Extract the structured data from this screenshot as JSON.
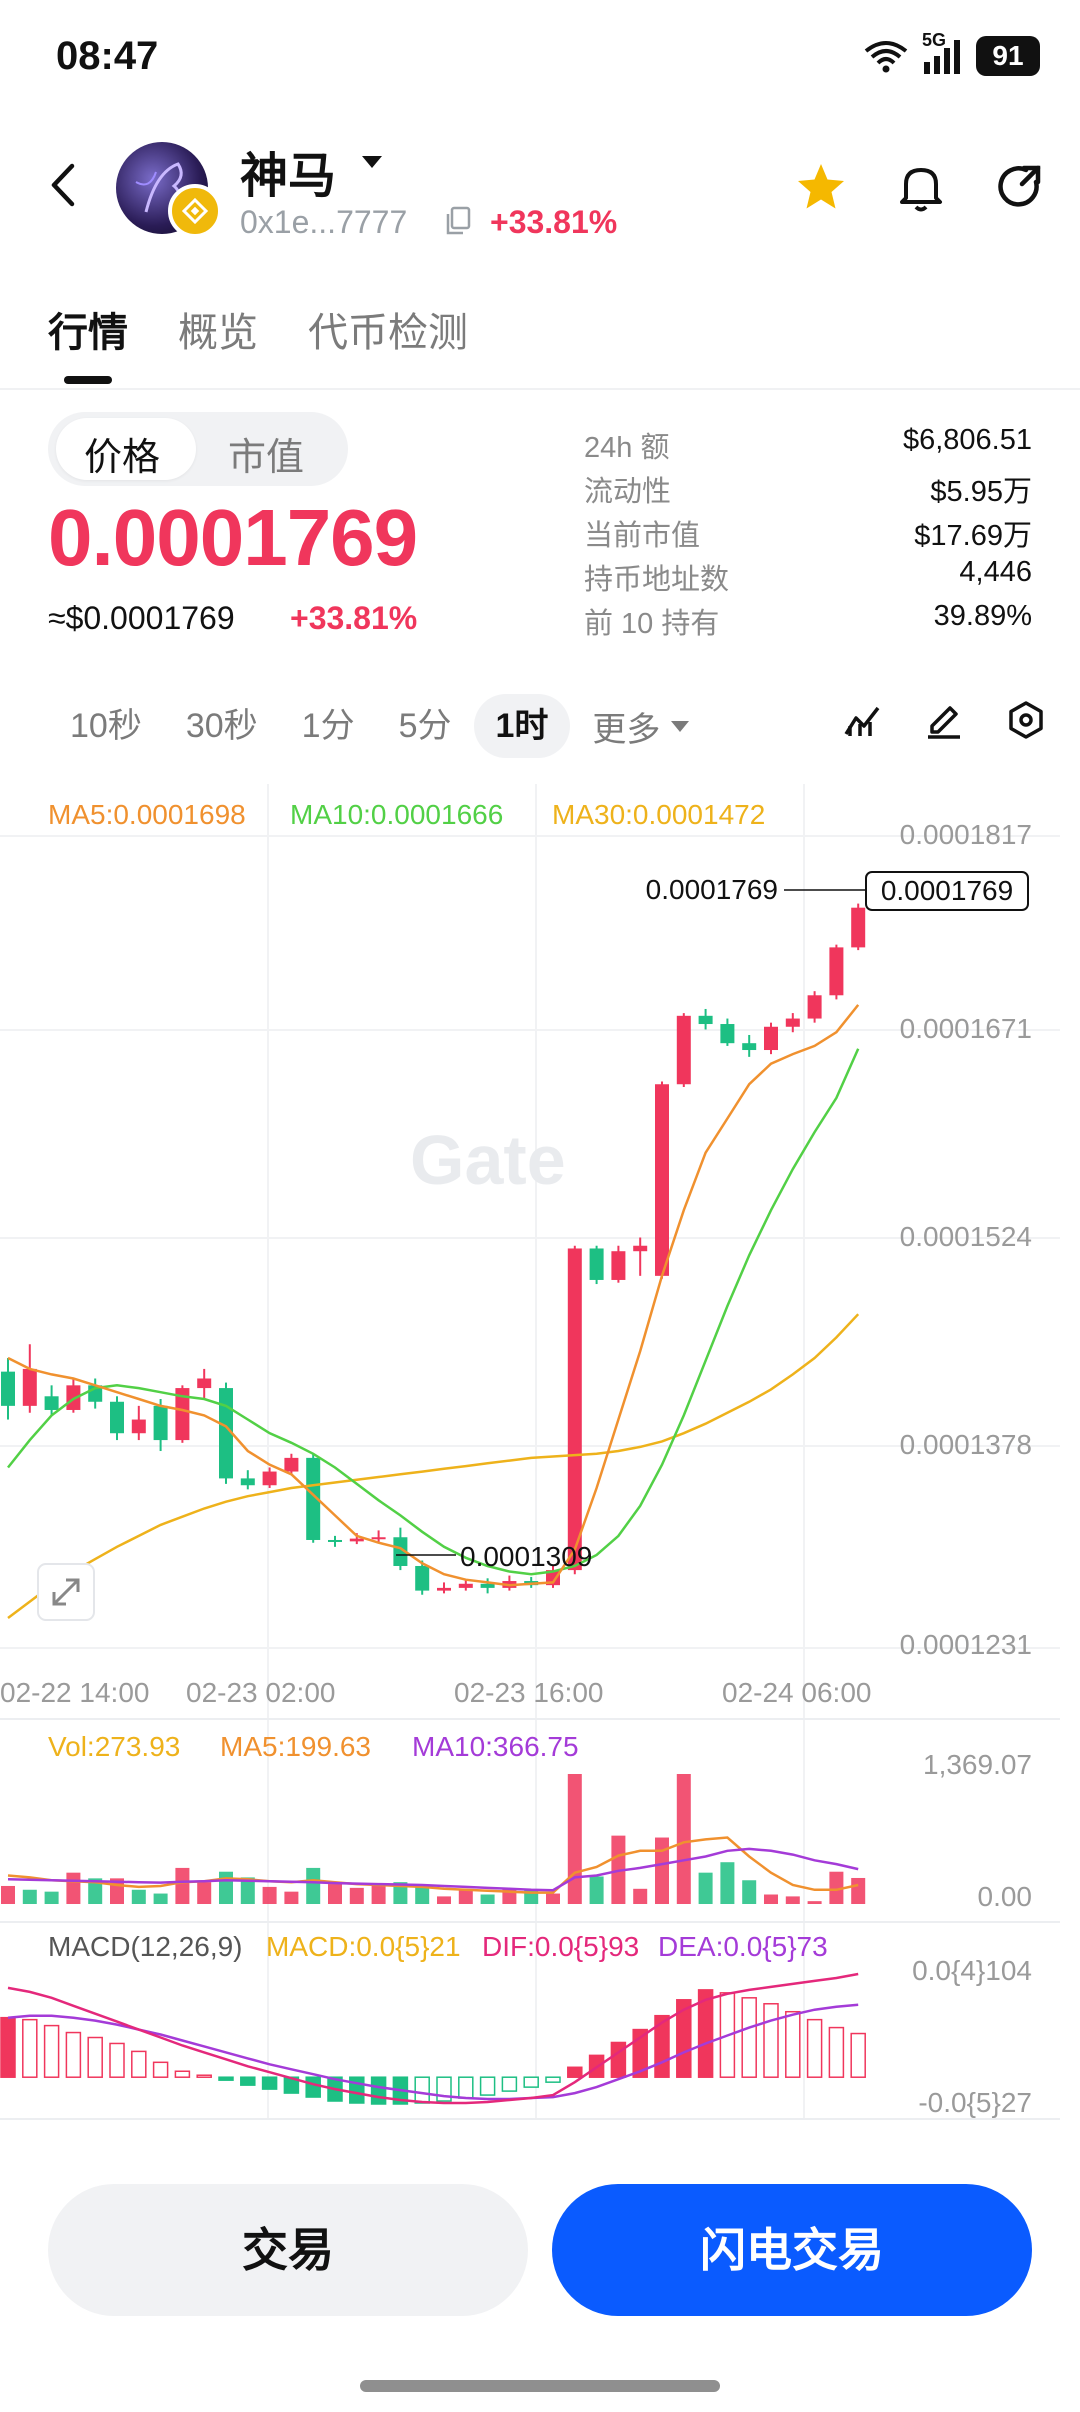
{
  "status": {
    "time": "08:47",
    "network": "5G",
    "battery": "91"
  },
  "header": {
    "token_name": "神马",
    "address": "0x1e...7777",
    "change": "+33.81%",
    "icons": [
      "back-icon",
      "dropdown-icon",
      "copy-icon",
      "star-icon",
      "bell-icon",
      "share-icon"
    ]
  },
  "tabs": [
    "行情",
    "概览",
    "代币检测"
  ],
  "price_panel": {
    "toggle": [
      "价格",
      "市值"
    ],
    "price": "0.0001769",
    "usd": "≈$0.0001769",
    "change": "+33.81%",
    "stats": [
      {
        "label": "24h  额",
        "value": "$6,806.51"
      },
      {
        "label": "流动性",
        "value": "$5.95万"
      },
      {
        "label": "当前市值",
        "value": "$17.69万"
      },
      {
        "label": "持币地址数",
        "value": "4,446"
      },
      {
        "label": "前 10 持有",
        "value": "39.89%"
      }
    ]
  },
  "intervals": [
    "10秒",
    "30秒",
    "1分",
    "5分",
    "1时"
  ],
  "more_label": "更多",
  "main_chart": {
    "ma5": "MA5:0.0001698",
    "ma10": "MA10:0.0001666",
    "ma30": "MA30:0.0001472",
    "y_ticks": [
      "0.0001817",
      "0.0001671",
      "0.0001524",
      "0.0001378",
      "0.0001231"
    ],
    "x_ticks": [
      "02-22 14:00",
      "02-23 02:00",
      "02-23 16:00",
      "02-24 06:00"
    ],
    "current_label": "0.0001769",
    "current_box": "0.0001769",
    "low_label": "0.0001309",
    "watermark": "Gate"
  },
  "volume_chart": {
    "vol": "Vol:273.93",
    "ma5": "MA5:199.63",
    "ma10": "MA10:366.75",
    "y_top": "1,369.07",
    "y_bottom": "0.00"
  },
  "macd_chart": {
    "title": "MACD(12,26,9)",
    "macd": "MACD:0.0{5}21",
    "dif": "DIF:0.0{5}93",
    "dea": "DEA:0.0{5}73",
    "y_top": "0.0{4}104",
    "y_bottom": "-0.0{5}27"
  },
  "colors": {
    "up": "#f0365c",
    "down": "#1dbf83",
    "ma5": "#f0912f",
    "ma10": "#52d046",
    "ma30": "#eeb21b",
    "macd_dif": "#e4287b",
    "macd_dea": "#a43bd8",
    "accent": "#0a5bff"
  },
  "buttons": {
    "trade": "交易",
    "flash_trade": "闪电交易"
  },
  "chart_data": {
    "type": "candlestick",
    "candles": [
      {
        "o": 0.000143,
        "c": 0.0001405,
        "h": 0.000144,
        "l": 0.0001395
      },
      {
        "o": 0.0001405,
        "c": 0.0001432,
        "h": 0.000145,
        "l": 0.00014
      },
      {
        "o": 0.0001412,
        "c": 0.0001402,
        "h": 0.000142,
        "l": 0.0001398
      },
      {
        "o": 0.0001402,
        "c": 0.000142,
        "h": 0.0001425,
        "l": 0.00014
      },
      {
        "o": 0.000142,
        "c": 0.0001408,
        "h": 0.0001425,
        "l": 0.0001403
      },
      {
        "o": 0.0001408,
        "c": 0.0001385,
        "h": 0.0001412,
        "l": 0.000138
      },
      {
        "o": 0.0001385,
        "c": 0.0001395,
        "h": 0.0001405,
        "l": 0.000138
      },
      {
        "o": 0.0001405,
        "c": 0.000138,
        "h": 0.000141,
        "l": 0.0001372
      },
      {
        "o": 0.000138,
        "c": 0.0001418,
        "h": 0.000142,
        "l": 0.0001378
      },
      {
        "o": 0.0001418,
        "c": 0.0001425,
        "h": 0.0001432,
        "l": 0.000141
      },
      {
        "o": 0.0001418,
        "c": 0.0001352,
        "h": 0.0001422,
        "l": 0.0001348
      },
      {
        "o": 0.0001352,
        "c": 0.0001347,
        "h": 0.0001358,
        "l": 0.0001344
      },
      {
        "o": 0.0001347,
        "c": 0.0001357,
        "h": 0.000136,
        "l": 0.0001345
      },
      {
        "o": 0.0001357,
        "c": 0.0001367,
        "h": 0.000137,
        "l": 0.0001355
      },
      {
        "o": 0.0001367,
        "c": 0.0001307,
        "h": 0.000137,
        "l": 0.0001305
      },
      {
        "o": 0.0001307,
        "c": 0.0001306,
        "h": 0.000131,
        "l": 0.0001302
      },
      {
        "o": 0.0001306,
        "c": 0.0001308,
        "h": 0.0001312,
        "l": 0.0001304
      },
      {
        "o": 0.0001308,
        "c": 0.0001309,
        "h": 0.0001314,
        "l": 0.0001305
      },
      {
        "o": 0.0001309,
        "c": 0.0001288,
        "h": 0.0001316,
        "l": 0.0001285
      },
      {
        "o": 0.0001288,
        "c": 0.000127,
        "h": 0.0001292,
        "l": 0.0001267
      },
      {
        "o": 0.000127,
        "c": 0.0001272,
        "h": 0.0001276,
        "l": 0.0001268
      },
      {
        "o": 0.0001272,
        "c": 0.0001275,
        "h": 0.0001278,
        "l": 0.000127
      },
      {
        "o": 0.0001275,
        "c": 0.0001272,
        "h": 0.0001279,
        "l": 0.0001268
      },
      {
        "o": 0.0001272,
        "c": 0.0001277,
        "h": 0.0001281,
        "l": 0.000127
      },
      {
        "o": 0.0001277,
        "c": 0.0001274,
        "h": 0.000128,
        "l": 0.0001272
      },
      {
        "o": 0.0001274,
        "c": 0.0001285,
        "h": 0.0001288,
        "l": 0.0001272
      },
      {
        "o": 0.0001285,
        "c": 0.000152,
        "h": 0.0001522,
        "l": 0.0001282
      },
      {
        "o": 0.000152,
        "c": 0.0001497,
        "h": 0.0001522,
        "l": 0.0001494
      },
      {
        "o": 0.0001497,
        "c": 0.0001518,
        "h": 0.0001522,
        "l": 0.0001495
      },
      {
        "o": 0.0001518,
        "c": 0.0001522,
        "h": 0.0001528,
        "l": 0.00015
      },
      {
        "o": 0.00015,
        "c": 0.000164,
        "h": 0.0001642,
        "l": 0.0001498
      },
      {
        "o": 0.000164,
        "c": 0.000169,
        "h": 0.0001692,
        "l": 0.0001638
      },
      {
        "o": 0.000169,
        "c": 0.0001684,
        "h": 0.0001695,
        "l": 0.000168
      },
      {
        "o": 0.0001684,
        "c": 0.000167,
        "h": 0.0001688,
        "l": 0.0001668
      },
      {
        "o": 0.000167,
        "c": 0.0001665,
        "h": 0.0001676,
        "l": 0.000166
      },
      {
        "o": 0.0001665,
        "c": 0.0001682,
        "h": 0.0001685,
        "l": 0.0001662
      },
      {
        "o": 0.0001682,
        "c": 0.0001688,
        "h": 0.0001692,
        "l": 0.0001678
      },
      {
        "o": 0.0001688,
        "c": 0.0001705,
        "h": 0.0001708,
        "l": 0.0001685
      },
      {
        "o": 0.0001705,
        "c": 0.000174,
        "h": 0.0001742,
        "l": 0.0001702
      },
      {
        "o": 0.000174,
        "c": 0.0001769,
        "h": 0.0001772,
        "l": 0.0001738
      }
    ],
    "ma5": [
      0.000144,
      0.0001432,
      0.0001428,
      0.0001425,
      0.000142,
      0.0001415,
      0.000141,
      0.0001405,
      0.0001402,
      0.0001398,
      0.000139,
      0.0001372,
      0.0001362,
      0.0001355,
      0.000134,
      0.0001325,
      0.000131,
      0.0001305,
      0.0001301,
      0.000129,
      0.0001282,
      0.0001278,
      0.0001276,
      0.0001274,
      0.0001275,
      0.0001276,
      0.00013,
      0.0001345,
      0.0001395,
      0.0001445,
      0.00015,
      0.0001548,
      0.000159,
      0.0001615,
      0.000164,
      0.0001655,
      0.0001662,
      0.0001668,
      0.0001678,
      0.0001698
    ],
    "ma10": [
      0.000136,
      0.000138,
      0.0001398,
      0.000141,
      0.0001418,
      0.000142,
      0.0001418,
      0.0001415,
      0.0001412,
      0.000141,
      0.0001405,
      0.0001395,
      0.0001385,
      0.0001378,
      0.000137,
      0.000136,
      0.0001348,
      0.0001336,
      0.0001325,
      0.0001313,
      0.0001302,
      0.0001294,
      0.0001288,
      0.0001284,
      0.0001282,
      0.0001284,
      0.0001288,
      0.0001296,
      0.000131,
      0.0001332,
      0.0001362,
      0.0001398,
      0.0001438,
      0.0001478,
      0.0001515,
      0.0001548,
      0.0001578,
      0.0001605,
      0.000163,
      0.0001666
    ],
    "ma30": [
      0.000125,
      0.0001262,
      0.0001274,
      0.0001284,
      0.0001293,
      0.0001302,
      0.000131,
      0.0001318,
      0.0001324,
      0.000133,
      0.0001335,
      0.0001339,
      0.0001342,
      0.0001345,
      0.0001347,
      0.0001349,
      0.0001351,
      0.0001353,
      0.0001355,
      0.0001357,
      0.0001359,
      0.0001361,
      0.0001363,
      0.0001365,
      0.0001367,
      0.0001368,
      0.0001369,
      0.000137,
      0.0001372,
      0.0001375,
      0.0001379,
      0.0001385,
      0.0001392,
      0.00014,
      0.0001408,
      0.0001417,
      0.0001428,
      0.000144,
      0.0001455,
      0.0001472
    ],
    "ylim": [
      0.0001231,
      0.0001817
    ],
    "volume": [
      190,
      150,
      130,
      330,
      270,
      270,
      150,
      110,
      380,
      230,
      340,
      280,
      180,
      130,
      380,
      210,
      170,
      190,
      230,
      200,
      80,
      150,
      100,
      160,
      150,
      110,
      1369,
      290,
      720,
      160,
      700,
      1369,
      330,
      440,
      250,
      100,
      80,
      30,
      340,
      274
    ],
    "volume_up": [
      true,
      false,
      false,
      true,
      false,
      true,
      false,
      false,
      true,
      true,
      false,
      false,
      true,
      true,
      false,
      true,
      true,
      true,
      false,
      false,
      true,
      true,
      false,
      true,
      false,
      true,
      true,
      false,
      true,
      true,
      true,
      true,
      false,
      false,
      false,
      true,
      true,
      true,
      true,
      true
    ],
    "vol_ma5": [
      300,
      280,
      250,
      240,
      230,
      200,
      180,
      190,
      230,
      240,
      270,
      260,
      240,
      230,
      250,
      230,
      210,
      200,
      190,
      180,
      160,
      150,
      140,
      130,
      120,
      120,
      330,
      390,
      510,
      560,
      560,
      650,
      680,
      700,
      500,
      330,
      200,
      150,
      150,
      200
    ],
    "vol_ma10": [
      260,
      255,
      250,
      245,
      240,
      235,
      230,
      225,
      235,
      240,
      250,
      245,
      240,
      235,
      230,
      220,
      215,
      210,
      205,
      200,
      190,
      180,
      170,
      160,
      150,
      145,
      280,
      300,
      350,
      380,
      420,
      460,
      500,
      560,
      580,
      560,
      520,
      460,
      420,
      367
    ],
    "macd_hist": [
      6e-06,
      5.8e-06,
      5.2e-06,
      4.5e-06,
      4e-06,
      3.4e-06,
      2.6e-06,
      1.5e-06,
      6e-07,
      2e-07,
      -3e-07,
      -8e-07,
      -1.2e-06,
      -1.6e-06,
      -2e-06,
      -2.4e-06,
      -2.6e-06,
      -2.7e-06,
      -2.7e-06,
      -2.6e-06,
      -2.4e-06,
      -2.1e-06,
      -1.8e-06,
      -1.4e-06,
      -1e-06,
      -5e-07,
      1e-06,
      2.2e-06,
      3.5e-06,
      4.8e-06,
      6.2e-06,
      7.8e-06,
      8.8e-06,
      8.5e-06,
      8e-06,
      7.4e-06,
      6.6e-06,
      5.8e-06,
      5e-06,
      4.4e-06
    ],
    "macd_dif": [
      9e-06,
      8.6e-06,
      8e-06,
      7.2e-06,
      6.4e-06,
      5.6e-06,
      4.8e-06,
      4e-06,
      3.2e-06,
      2.5e-06,
      1.8e-06,
      1.1e-06,
      5e-07,
      -1e-07,
      -7e-07,
      -1.2e-06,
      -1.6e-06,
      -2e-06,
      -2.3e-06,
      -2.5e-06,
      -2.6e-06,
      -2.6e-06,
      -2.5e-06,
      -2.3e-06,
      -2.1e-06,
      -1.8e-06,
      -5e-07,
      1e-06,
      2.5e-06,
      4e-06,
      5.5e-06,
      6.8e-06,
      7.8e-06,
      8.4e-06,
      8.8e-06,
      9.1e-06,
      9.4e-06,
      9.7e-06,
      1e-05,
      1.04e-05
    ],
    "macd_dea": [
      6e-06,
      6.2e-06,
      6.2e-06,
      6e-06,
      5.7e-06,
      5.3e-06,
      4.8e-06,
      4.3e-06,
      3.7e-06,
      3.1e-06,
      2.5e-06,
      1.9e-06,
      1.3e-06,
      8e-07,
      3e-07,
      -2e-07,
      -6e-07,
      -1e-06,
      -1.3e-06,
      -1.6e-06,
      -1.9e-06,
      -2.1e-06,
      -2.2e-06,
      -2.2e-06,
      -2.1e-06,
      -2e-06,
      -1.6e-06,
      -1e-06,
      -2e-07,
      6e-07,
      1.5e-06,
      2.5e-06,
      3.4e-06,
      4.2e-06,
      5e-06,
      5.7e-06,
      6.3e-06,
      6.8e-06,
      7.1e-06,
      7.3e-06
    ],
    "macd_ylim": [
      -2.7e-06,
      1.04e-05
    ]
  }
}
